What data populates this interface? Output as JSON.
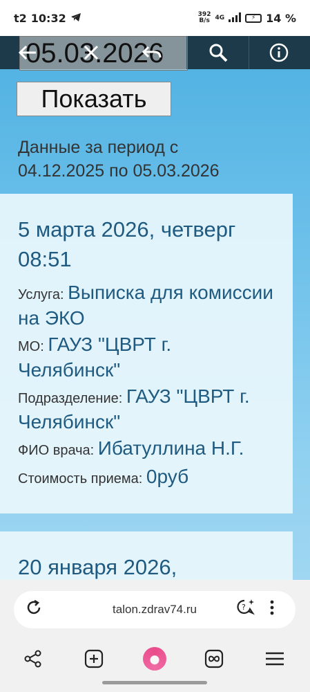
{
  "status_bar": {
    "carrier": "t2",
    "time": "10:32",
    "net_speed_value": "392",
    "net_speed_unit": "B/s",
    "network": "4G",
    "battery_percent": "14 %"
  },
  "toolbar": {
    "date_value": "05.03.2026",
    "back_icon": "arrow-left-icon",
    "clear_icon": "close-icon",
    "undo_icon": "undo-icon",
    "search_icon": "search-icon",
    "info_icon": "info-icon"
  },
  "show_button": "Показать",
  "period": {
    "line1": "Данные за период с",
    "line2": "04.12.2025 по 05.03.2026"
  },
  "records": [
    {
      "date": "5 марта 2026, четверг",
      "time": "08:51",
      "service_label": "Услуга: ",
      "service": "Выписка для комиссии на ЭКО",
      "mo_label": "МО: ",
      "mo": "ГАУЗ \"ЦВРТ г. Челябинск\"",
      "dept_label": "Подразделение: ",
      "dept": "ГАУЗ \"ЦВРТ г. Челябинск\"",
      "doctor_label": "ФИО врача: ",
      "doctor": "Ибатуллина Н.Г.",
      "cost_label": "Стоимость приема: ",
      "cost": "0руб"
    },
    {
      "date": "20 января 2026,"
    }
  ],
  "address_bar": {
    "url": "talon.zdrav74.ru"
  },
  "colors": {
    "link": "#1f5a80",
    "toolbar": "#1c3a4a",
    "alice": "#e94b8a"
  }
}
